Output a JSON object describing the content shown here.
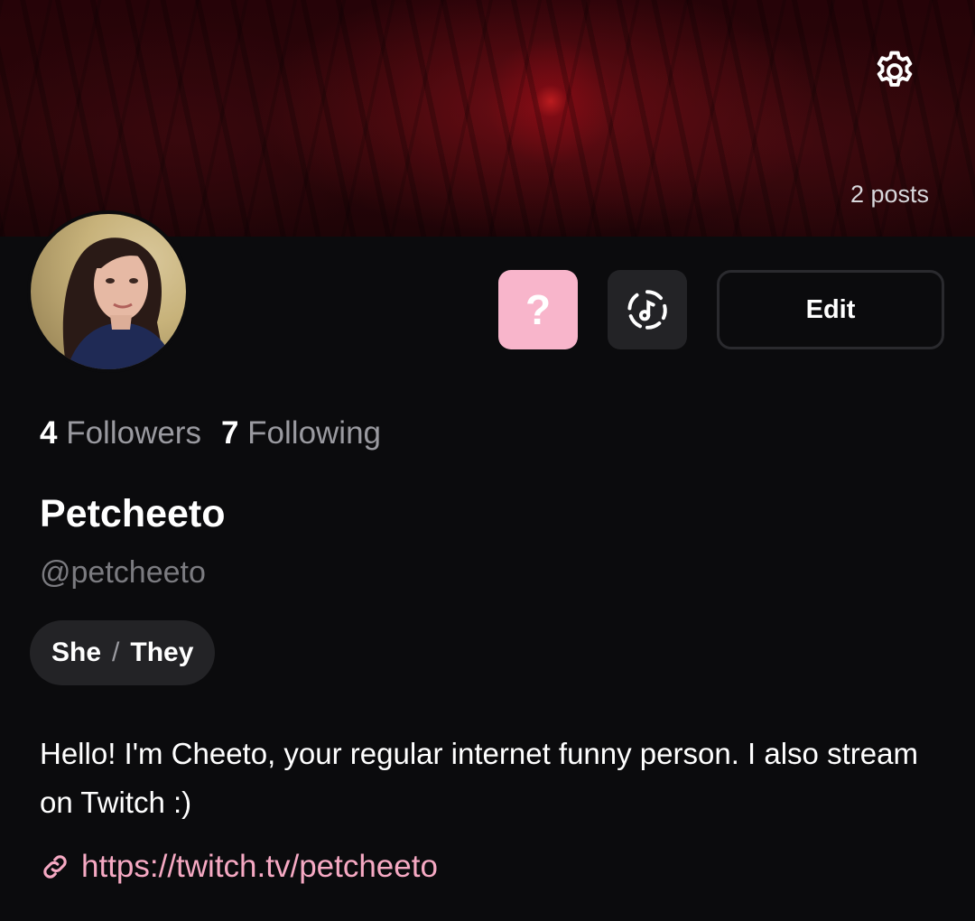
{
  "banner": {
    "posts_count": "2 posts",
    "settings_icon": "gear-icon"
  },
  "profile": {
    "avatar_icon": "avatar",
    "display_name": "Petcheeto",
    "handle": "@petcheeto",
    "pronouns": {
      "first": "She",
      "separator": "/",
      "second": "They"
    },
    "bio": "Hello! I'm Cheeto, your regular internet funny person. I also stream on Twitch :)",
    "link": "https://twitch.tv/petcheeto"
  },
  "actions": {
    "question_label": "?",
    "music_icon": "music-disc-icon",
    "edit_label": "Edit"
  },
  "stats": {
    "followers_count": "4",
    "followers_label": "Followers",
    "following_count": "7",
    "following_label": "Following"
  },
  "colors": {
    "background": "#0b0b0d",
    "accent_pink": "#f8b5cb",
    "link_pink": "#f6a9c3",
    "chip_bg": "#232326",
    "muted_text": "#9a9aa0"
  }
}
